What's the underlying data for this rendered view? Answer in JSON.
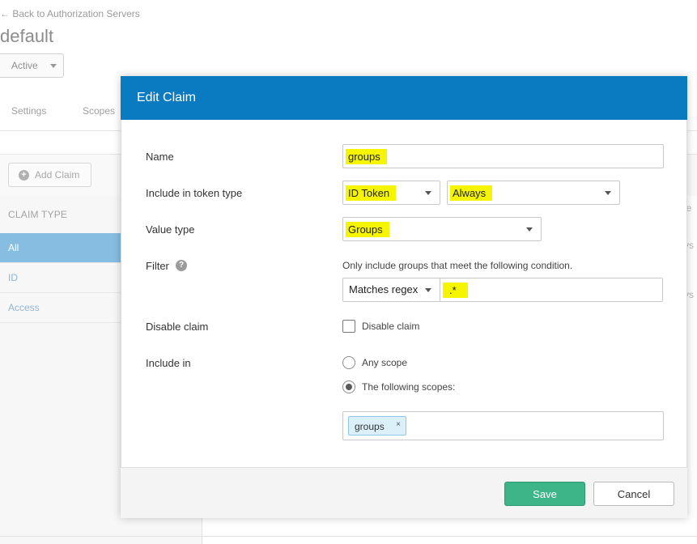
{
  "background": {
    "back_link": "← Back to Authorization Servers",
    "title": "default",
    "status": "Active",
    "tabs": [
      "Settings",
      "Scopes"
    ],
    "add_claim": "Add Claim",
    "claim_type_heading": "CLAIM TYPE",
    "claim_types": [
      "All",
      "ID",
      "Access"
    ],
    "right_col_fragments": [
      "ie",
      "ys",
      "ys"
    ]
  },
  "modal": {
    "title": "Edit Claim",
    "name": {
      "label": "Name",
      "value": "groups"
    },
    "token_type": {
      "label": "Include in token type",
      "type_value": "ID Token",
      "when_value": "Always"
    },
    "value_type": {
      "label": "Value type",
      "value": "Groups"
    },
    "filter": {
      "label": "Filter",
      "help_icon": "?",
      "hint": "Only include groups that meet the following condition.",
      "operator": "Matches regex",
      "value": ".*"
    },
    "disable_claim": {
      "label": "Disable claim",
      "checkbox_label": "Disable claim",
      "checked": false
    },
    "include_in": {
      "label": "Include in",
      "options": [
        "Any scope",
        "The following scopes:"
      ],
      "selected": "The following scopes:",
      "scopes": [
        "groups"
      ],
      "remove_glyph": "×"
    },
    "buttons": {
      "save": "Save",
      "cancel": "Cancel"
    }
  },
  "colors": {
    "header": "#0a7bc1",
    "save": "#3db589",
    "highlight": "#f5f500",
    "active_side": "#86bde0"
  }
}
